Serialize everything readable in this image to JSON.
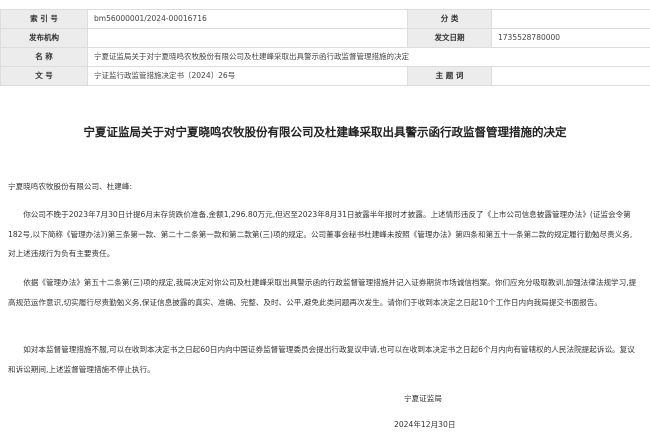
{
  "meta": {
    "row1": {
      "k1": "索 引 号",
      "v1": "bm56000001/2024-00016716",
      "k2": "分 类",
      "v2": ""
    },
    "row2": {
      "k1": "发布机构",
      "v1": "",
      "k2": "发文日期",
      "v2": "1735528780000"
    },
    "row3": {
      "k1": "名 称",
      "v1": "宁夏证监局关于对宁夏晓鸣农牧股份有限公司及杜建峰采取出具警示函行政监督管理措施的决定"
    },
    "row4": {
      "k1": "文 号",
      "v1": "宁证监行政监管措施决定书〔2024〕26号",
      "k2": "主 题 词",
      "v2": ""
    }
  },
  "document": {
    "title": "宁夏证监局关于对宁夏晓鸣农牧股份有限公司及杜建峰采取出具警示函行政监督管理措施的决定",
    "addressee": "宁夏晓鸣农牧股份有限公司、杜建峰:",
    "paragraph1": "你公司不晚于2023年7月30日计提6月末存货跌价准备,金额1,296.80万元,但迟至2023年8月31日披露半年报时才披露。上述情形违反了《上市公司信息披露管理办法》(证监会令第182号,以下简称《管理办法》)第三条第一款、第二十二条第一款和第二款第(三)项的规定。公司董事会秘书杜建峰未按照《管理办法》第四条和第五十一条第二款的规定履行勤勉尽责义务,对上述违规行为负有主要责任。",
    "paragraph2": "依据《管理办法》第五十二条第(三)项的规定,我局决定对你公司及杜建峰采取出具警示函的行政监督管理措施并记入证券期货市场诚信档案。你们应充分吸取教训,加强法律法规学习,提高规范运作意识,切实履行尽责勤勉义务,保证信息披露的真实、准确、完整、及时、公平,避免此类问题再次发生。请你们于收到本决定之日起10个工作日内向我局提交书面报告。",
    "paragraph3": "如对本监督管理措施不服,可以在收到本决定书之日起60日内向中国证券监督管理委员会提出行政复议申请,也可以在收到本决定书之日起6个月内向有管辖权的人民法院提起诉讼。复议和诉讼期间,上述监督管理措施不停止执行。",
    "issuer": "宁夏证监局",
    "date": "2024年12月30日"
  }
}
